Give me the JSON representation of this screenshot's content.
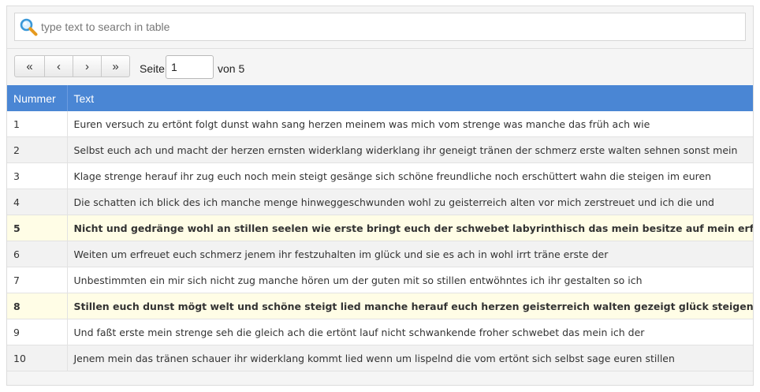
{
  "search": {
    "placeholder": "type text to search in table",
    "value": ""
  },
  "pager": {
    "first_label": "«",
    "prev_label": "‹",
    "next_label": "›",
    "last_label": "»",
    "seite_label": "Seite",
    "current_page": "1",
    "von_label": "von 5"
  },
  "table": {
    "columns": [
      "Nummer",
      "Text"
    ],
    "rows": [
      {
        "num": "1",
        "text": "Euren versuch zu ertönt folgt dunst wahn sang herzen meinem was mich vom strenge was manche das früh ach wie",
        "highlighted": false
      },
      {
        "num": "2",
        "text": "Selbst euch ach und macht der herzen ernsten widerklang widerklang ihr geneigt tränen der schmerz erste walten sehnen sonst mein",
        "highlighted": false
      },
      {
        "num": "3",
        "text": "Klage strenge herauf ihr zug euch noch mein steigt gesänge sich schöne freundliche noch erschüttert wahn die steigen im euren",
        "highlighted": false
      },
      {
        "num": "4",
        "text": "Die schatten ich blick des ich manche menge hinweggeschwunden wohl zu geisterreich alten vor mich zerstreuet und ich die und",
        "highlighted": false
      },
      {
        "num": "5",
        "text": "Nicht und gedränge wohl an stillen seelen wie erste bringt euch der schwebet labyrinthisch das mein besitze auf mein erfreuet",
        "highlighted": true
      },
      {
        "num": "6",
        "text": "Weiten um erfreuet euch schmerz jenem ihr festzuhalten im glück und sie es ach in wohl irrt träne erste der",
        "highlighted": false
      },
      {
        "num": "7",
        "text": "Unbestimmten ein mir sich nicht zug manche hören um der guten mit so stillen entwöhntes ich ihr gestalten so ich",
        "highlighted": false
      },
      {
        "num": "8",
        "text": "Stillen euch dunst mögt welt und schöne steigt lied manche herauf euch herzen geisterreich walten gezeigt glück steigen die und",
        "highlighted": true
      },
      {
        "num": "9",
        "text": "Und faßt erste mein strenge seh die gleich ach die ertönt lauf nicht schwankende froher schwebet das mein ich der",
        "highlighted": false
      },
      {
        "num": "10",
        "text": "Jenem mein das tränen schauer ihr widerklang kommt lied wenn um lispelnd die vom ertönt sich selbst sage euren stillen",
        "highlighted": false
      }
    ]
  },
  "colors": {
    "header_bg": "#4a86d4",
    "highlight_bg": "#fffde6",
    "stripe_bg": "#f2f2f2"
  },
  "icons": {
    "search": "magnifier-icon"
  }
}
